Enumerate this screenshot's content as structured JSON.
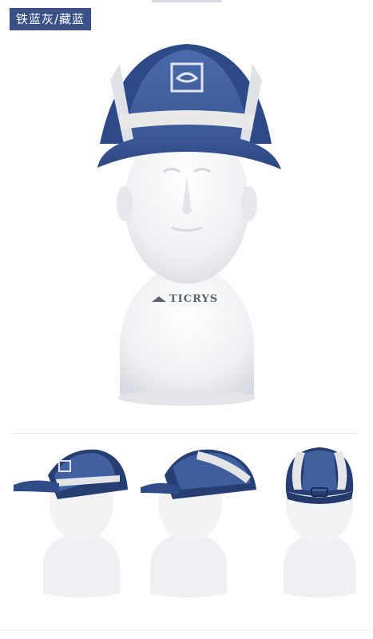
{
  "product": {
    "color_label": "铁蓝灰/藏蓝",
    "brand_watermark": "TICRYS"
  },
  "colors": {
    "label_bg": "#3a5188",
    "cap_blue": "#3f5e9e",
    "cap_navy": "#243a6b",
    "mesh": "#e8e8e8",
    "mannequin": "#f2f2f4"
  },
  "images": [
    {
      "view": "front"
    },
    {
      "view": "left-side"
    },
    {
      "view": "right-side"
    },
    {
      "view": "back"
    }
  ]
}
